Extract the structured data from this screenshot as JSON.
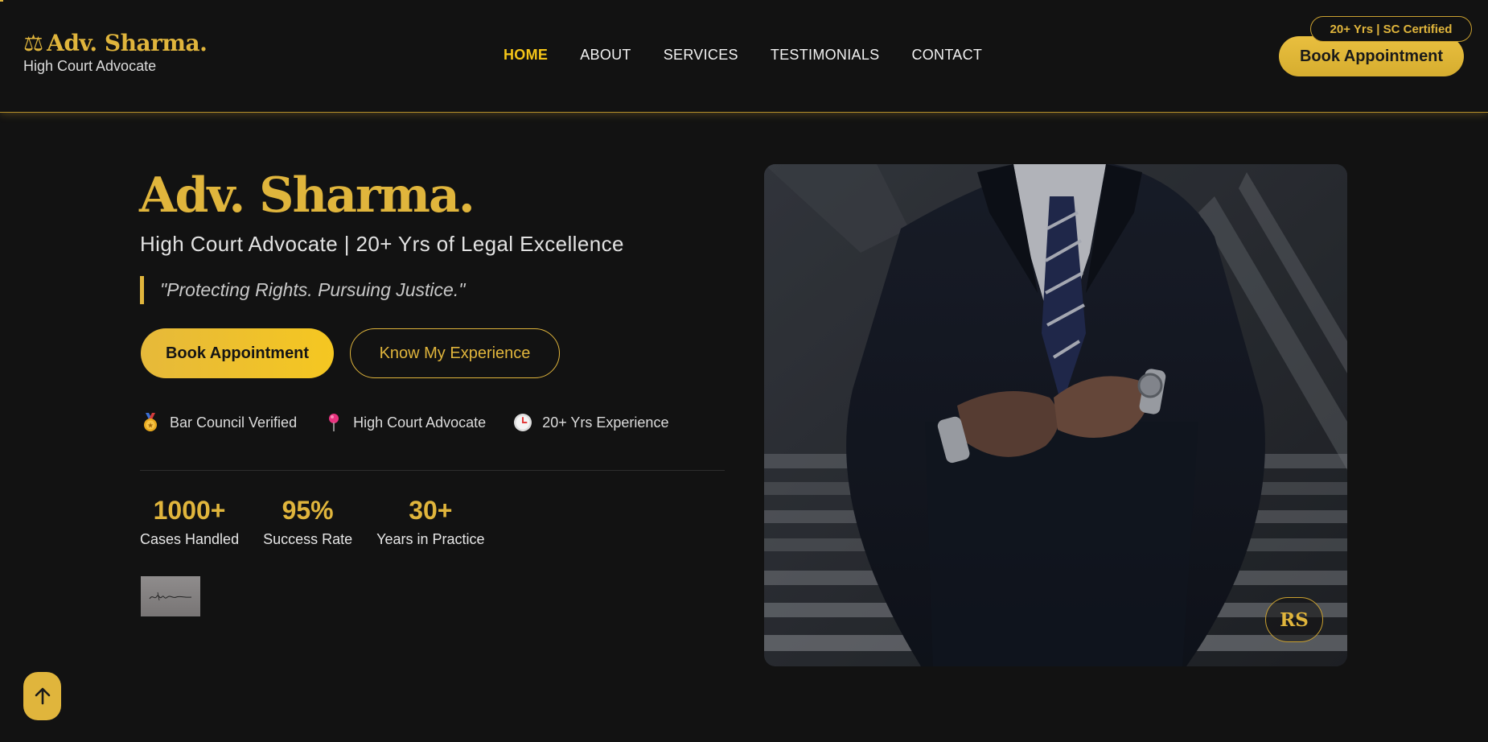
{
  "header": {
    "brand_icon": "balance-scale-icon",
    "brand_name": "Adv. Sharma.",
    "brand_subtitle": "High Court Advocate",
    "nav": [
      {
        "label": "HOME",
        "active": true
      },
      {
        "label": "ABOUT",
        "active": false
      },
      {
        "label": "SERVICES",
        "active": false
      },
      {
        "label": "TESTIMONIALS",
        "active": false
      },
      {
        "label": "CONTACT",
        "active": false
      }
    ],
    "cert_badge": "20+ Yrs | SC Certified",
    "book_button": "Book Appointment"
  },
  "hero": {
    "name": "Adv. Sharma.",
    "subtitle": "High Court Advocate | 20+ Yrs of Legal Excellence",
    "quote": "\"Protecting Rights. Pursuing Justice.\"",
    "primary_button": "Book Appointment",
    "secondary_button": "Know My Experience",
    "badges": [
      {
        "icon": "medal-icon",
        "label": "Bar Council Verified"
      },
      {
        "icon": "pushpin-icon",
        "label": "High Court Advocate"
      },
      {
        "icon": "clock-icon",
        "label": "20+ Yrs Experience"
      }
    ],
    "stats": [
      {
        "value": "1000+",
        "label": "Cases Handled"
      },
      {
        "value": "95%",
        "label": "Success Rate"
      },
      {
        "value": "30+",
        "label": "Years in Practice"
      }
    ],
    "photo_badge": "RS"
  },
  "colors": {
    "background": "#121212",
    "accent_gold": "#e0b53c",
    "active_nav": "#f5c518"
  }
}
